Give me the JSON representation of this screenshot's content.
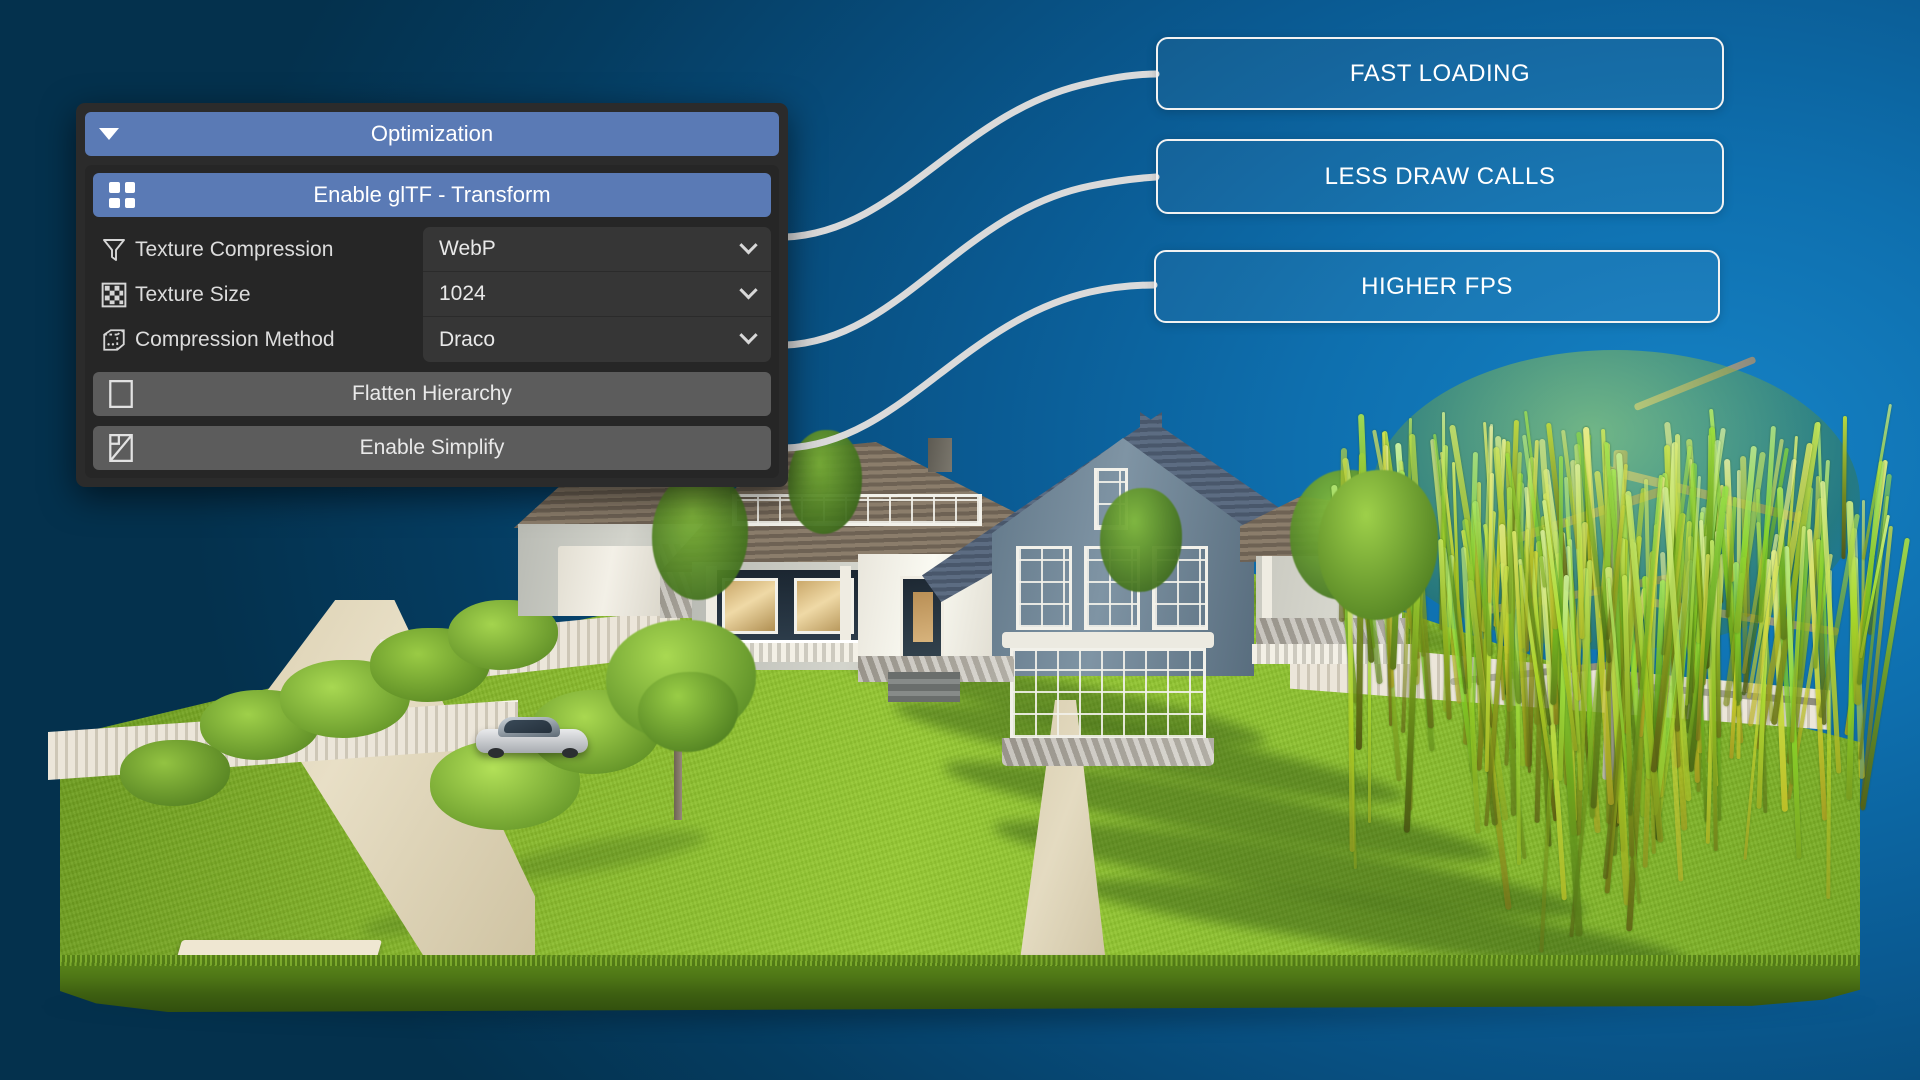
{
  "panel": {
    "header": {
      "title": "Optimization",
      "collapse_icon": "triangle-down-icon"
    },
    "gltf_toggle": {
      "label": "Enable glTF - Transform",
      "icon": "grid-2x2-icon",
      "active": true,
      "accent": "#5a7ab5"
    },
    "properties": [
      {
        "icon": "funnel-filter-icon",
        "label": "Texture Compression",
        "value": "WebP",
        "control": "dropdown"
      },
      {
        "icon": "checkerboard-texture-icon",
        "label": "Texture Size",
        "value": "1024",
        "control": "dropdown"
      },
      {
        "icon": "wireframe-cube-icon",
        "label": "Compression Method",
        "value": "Draco",
        "control": "dropdown"
      }
    ],
    "toggles": [
      {
        "icon": "empty-checkbox-icon",
        "label": "Flatten Hierarchy",
        "checked": false
      },
      {
        "icon": "simplify-mesh-icon",
        "label": "Enable Simplify",
        "checked": false
      }
    ],
    "colors": {
      "panel_bg": "#2b2b2b",
      "body_bg": "#262626",
      "field_bg": "#363636",
      "accent": "#5a7ab5",
      "toggle_bg": "#5c5c5c"
    }
  },
  "callouts": [
    {
      "label": "FAST LOADING"
    },
    {
      "label": "LESS DRAW CALLS"
    },
    {
      "label": "HIGHER FPS"
    }
  ],
  "scene": {
    "description": "3D rendered residential house on a green lawn diorama with a weeping willow tree, white picket fence, driveway with a silver car, and front walkway",
    "colors": {
      "grass": "#8ec22f",
      "background_dark": "#04314d",
      "background_light": "#1180c2",
      "connector_line": "#dadada"
    }
  }
}
